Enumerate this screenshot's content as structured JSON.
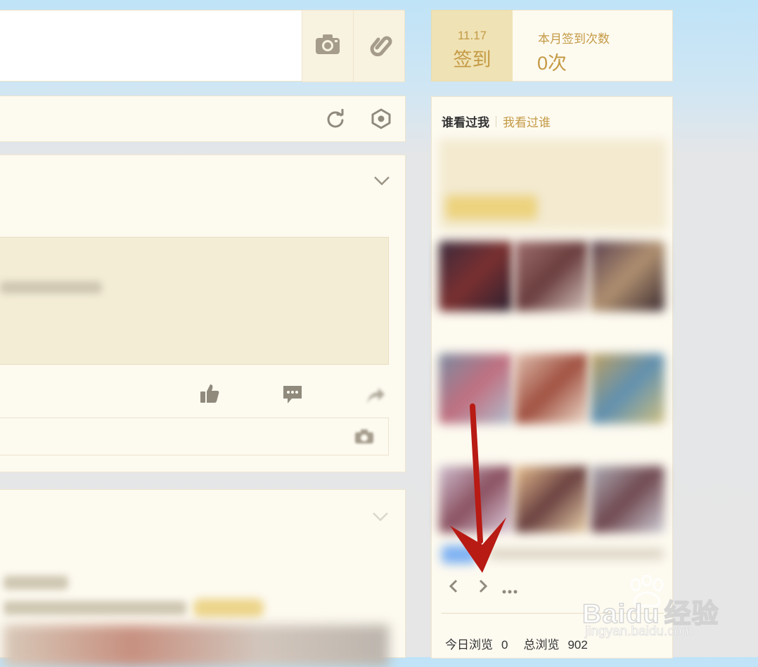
{
  "signin": {
    "date": "11.17",
    "button_label": "签到",
    "month_label": "本月签到次数",
    "month_count": "0次"
  },
  "visitors": {
    "tab_visited_me": "谁看过我",
    "tab_i_visited": "我看过谁"
  },
  "stats": {
    "today_label": "今日浏览",
    "today_value": "0",
    "total_label": "总浏览",
    "total_value": "902"
  },
  "watermark": {
    "brand": "Baidu",
    "suffix": "经验",
    "url": "jingyan.baidu.com"
  },
  "colors": {
    "accent_gold": "#c49a45",
    "signin_bg": "#efe2b4",
    "card_bg": "#fdfaf0",
    "arrow_red": "#b81a14"
  },
  "icons": [
    "camera-icon",
    "link-icon",
    "refresh-icon",
    "settings-hex-icon",
    "chevron-down-icon",
    "thumbs-up-icon",
    "comment-icon",
    "share-icon",
    "chevron-left-icon",
    "chevron-right-icon",
    "more-icon"
  ]
}
